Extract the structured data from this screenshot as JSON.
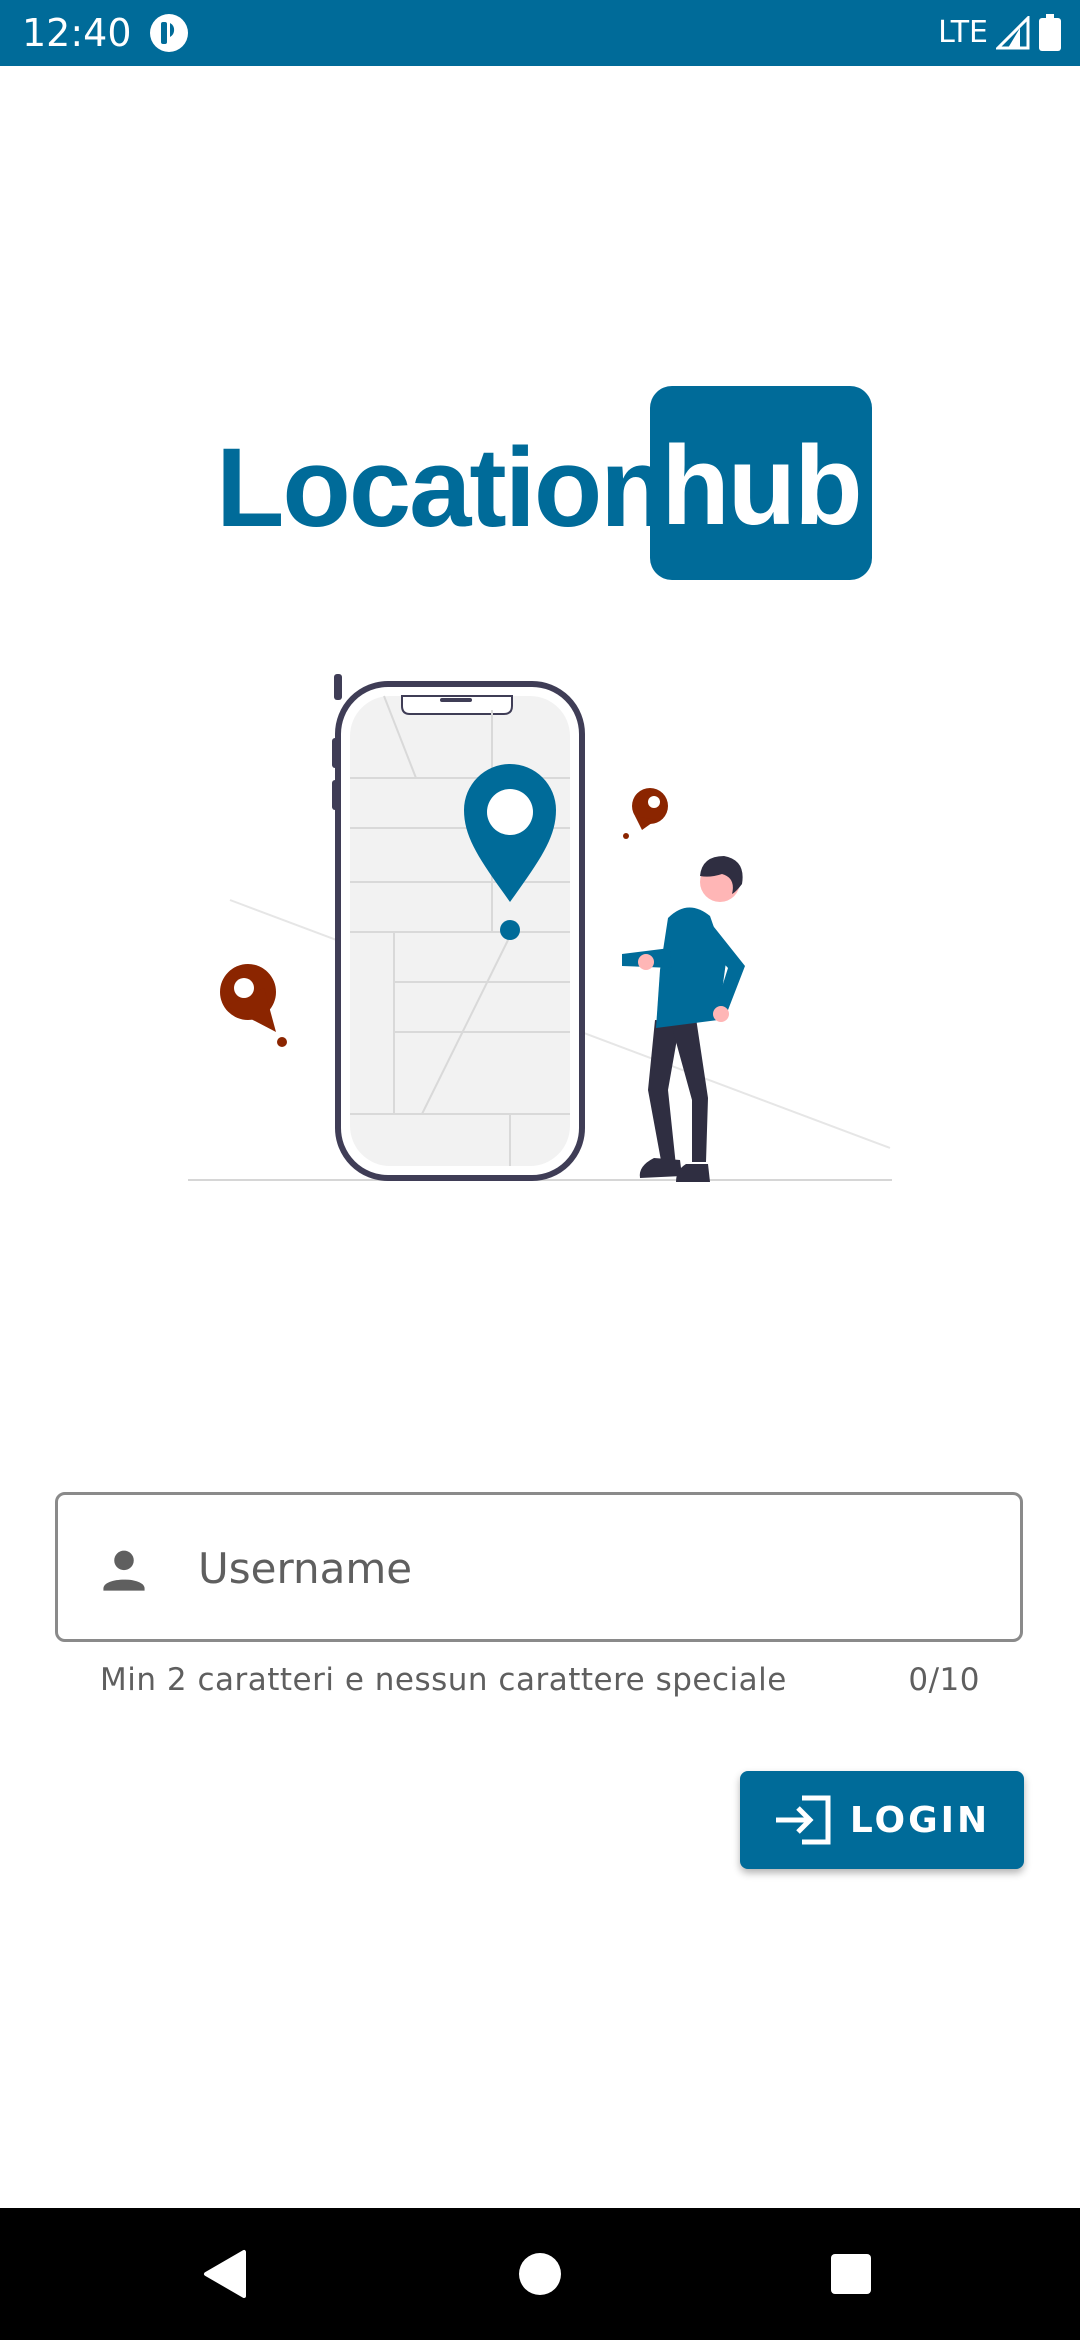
{
  "status_bar": {
    "time": "12:40",
    "network": "LTE"
  },
  "logo": {
    "word1": "Location",
    "word2": "hub"
  },
  "login_form": {
    "username_placeholder": "Username",
    "username_value": "",
    "helper_text": "Min 2 caratteri e nessun carattere speciale",
    "char_counter": "0/10",
    "login_label": "LOGIN"
  },
  "colors": {
    "brand": "#006B99",
    "pin_accent": "#8B2500",
    "phone_outline": "#3F3D56",
    "helper_text": "#5F5F5F",
    "field_border": "#8A8A8A"
  },
  "icons": {
    "status_app": "app-indicator-icon",
    "signal": "signal-icon",
    "battery": "battery-icon",
    "field_leading": "person-icon",
    "login": "login-icon",
    "nav_back": "back-icon",
    "nav_home": "home-icon",
    "nav_recents": "recents-icon"
  }
}
